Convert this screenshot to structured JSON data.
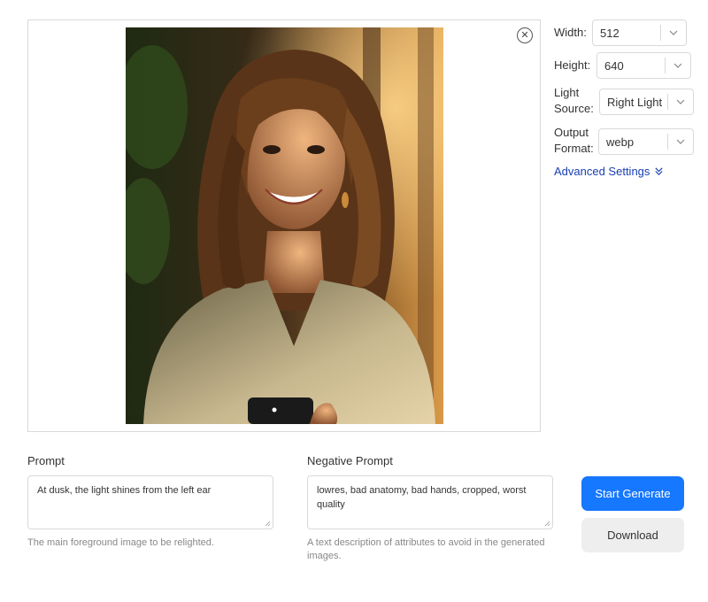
{
  "image_panel": {
    "close_icon": "close-circle-icon",
    "close_glyph": "✕"
  },
  "settings": {
    "width": {
      "label": "Width:",
      "value": "512"
    },
    "height": {
      "label": "Height:",
      "value": "640"
    },
    "light_source": {
      "label_line1": "Light",
      "label_line2": "Source:",
      "value": "Right Light"
    },
    "output_format": {
      "label_line1": "Output",
      "label_line2": "Format:",
      "value": "webp"
    },
    "advanced": {
      "label": "Advanced Settings",
      "icon": "double-chevron-down-icon"
    }
  },
  "prompt": {
    "label": "Prompt",
    "value": "At dusk, the light shines from the left ear",
    "help": "The main foreground image to be relighted."
  },
  "negative_prompt": {
    "label": "Negative Prompt",
    "value": "lowres, bad anatomy, bad hands, cropped, worst quality",
    "help": "A text description of attributes to avoid in the generated images."
  },
  "actions": {
    "generate_label": "Start Generate",
    "download_label": "Download"
  },
  "colors": {
    "primary": "#1677ff",
    "link": "#1a3fb0",
    "secondary_bg": "#eeeeee",
    "border": "#d9d9d9"
  }
}
